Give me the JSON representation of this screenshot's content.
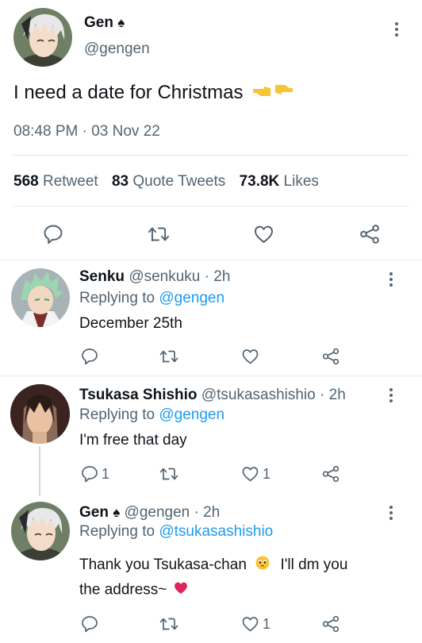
{
  "main_tweet": {
    "author_name": "Gen",
    "author_suffix": "♠",
    "handle": "@gengen",
    "text": "I need a date for Christmas",
    "text_emoji": "👉👈",
    "timestamp": "08:48 PM · 03 Nov 22",
    "stats": {
      "retweet_count": "568",
      "retweet_label": "Retweet",
      "quote_count": "83",
      "quote_label": "Quote Tweets",
      "like_count": "73.8K",
      "like_label": "Likes"
    }
  },
  "replies": [
    {
      "name": "Senku",
      "handle": "@senkuku",
      "time": "· 2h",
      "replying_label": "Replying to",
      "replying_to": "@gengen",
      "text": "December 25th",
      "reply_count": "",
      "like_count": ""
    },
    {
      "name": "Tsukasa Shishio",
      "handle": "@tsukasashishio",
      "time": "· 2h",
      "replying_label": "Replying to",
      "replying_to": "@gengen",
      "text": "I'm free that day",
      "reply_count": "1",
      "like_count": "1"
    },
    {
      "name": "Gen",
      "name_suffix": "♠",
      "handle": "@gengen",
      "time": "· 2h",
      "replying_label": "Replying to",
      "replying_to": "@tsukasashishio",
      "text_line1": "Thank you Tsukasa-chan",
      "text_line1_b": "I'll dm you",
      "text_line2": "the address~",
      "reply_count": "",
      "like_count": "1"
    }
  ],
  "colors": {
    "accent": "#1d9bf0",
    "text": "#0f1419",
    "muted": "#536471",
    "divider": "#e7e9ea"
  },
  "icons": [
    "reply-icon",
    "retweet-icon",
    "like-icon",
    "share-icon",
    "more-icon",
    "spade-icon"
  ]
}
